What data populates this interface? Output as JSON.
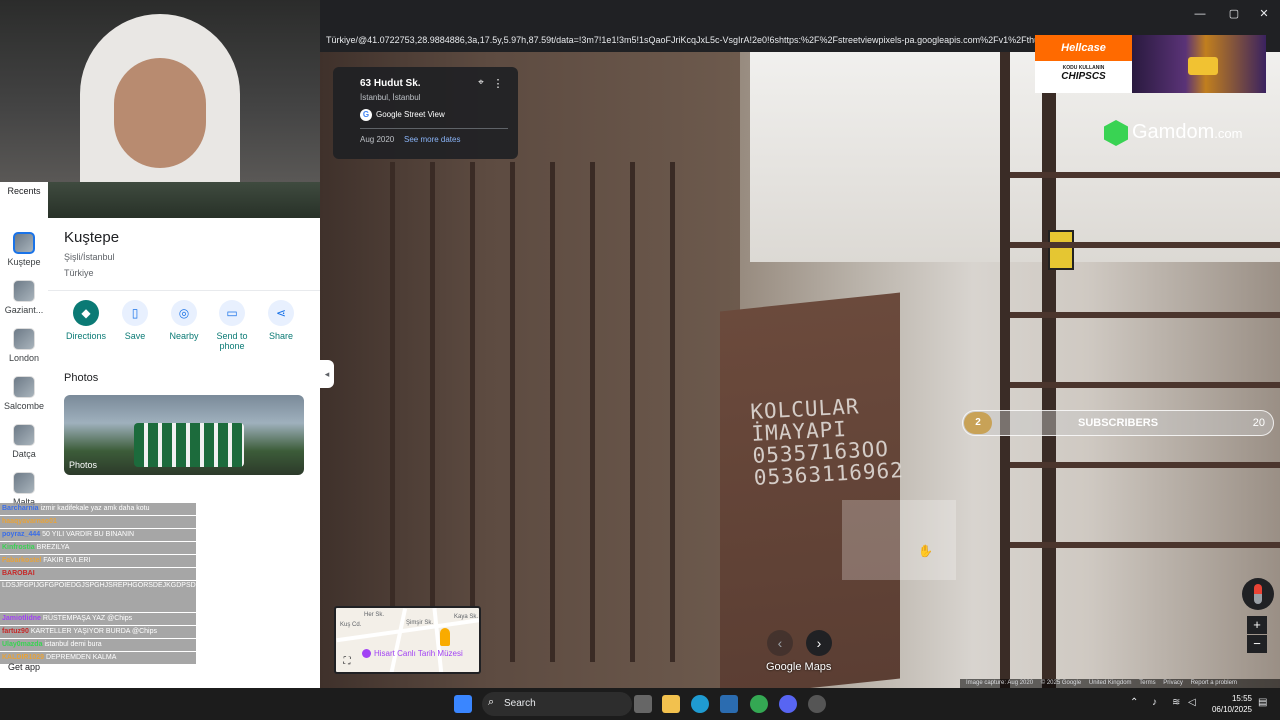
{
  "browser": {
    "url": "Türkiye/@41.0722753,28.9884886,3a,17.5y,5.97h,87.59t/data=!3m7!1e1!3m5!1sQaoFJriKcqJxL5c-VsgIrA!2e0!6shttps:%2F%2Fstreetviewpixels-pa.googleapis.com%2Fv1%2Fthu",
    "window_controls": {
      "minimize": "—",
      "maximize": "▢",
      "close": "✕"
    }
  },
  "rail": {
    "recents_label": "Recents",
    "items": [
      {
        "label": "Kuştepe",
        "active": true
      },
      {
        "label": "Gaziant...",
        "active": false
      },
      {
        "label": "London",
        "active": false
      },
      {
        "label": "Salcombe",
        "active": false
      },
      {
        "label": "Datça",
        "active": false
      },
      {
        "label": "Malta",
        "active": false
      }
    ],
    "get_app": "Get app"
  },
  "place": {
    "title": "Kuştepe",
    "district": "Şişli/İstanbul",
    "country": "Türkiye",
    "actions": [
      {
        "label": "Directions",
        "icon": "◆"
      },
      {
        "label": "Save",
        "icon": "▯"
      },
      {
        "label": "Nearby",
        "icon": "◎"
      },
      {
        "label": "Send to phone",
        "icon": "▭"
      },
      {
        "label": "Share",
        "icon": "⋖"
      }
    ],
    "photos_heading": "Photos",
    "photo_label": "Photos"
  },
  "streetview_card": {
    "address": "63 Hudut Sk.",
    "city": "İstanbul, İstanbul",
    "source": "Google Street View",
    "capture_date": "Aug 2020",
    "see_more": "See more dates"
  },
  "chat": [
    {
      "user": "Barcharnia",
      "text": "izmir kadifekale yaz amk daha kotu",
      "color": "#3a6ee8"
    },
    {
      "user": "haaqyavarnao01",
      "text": "",
      "color": "#e8a33a"
    },
    {
      "user": "poyraz_444",
      "text": "50 YILI VARDIR BU BINANIN",
      "color": "#3a6ee8"
    },
    {
      "user": "Kinfrostia",
      "text": "BREZILYA",
      "color": "#39d353"
    },
    {
      "user": "Fabarkostel",
      "text": "FAKIR EVLERI",
      "color": "#e8a33a"
    },
    {
      "user": "BAROBAI",
      "text": "",
      "color": "#c62828"
    },
    {
      "user": "",
      "text": "LDSJFGPIJGFGPOIEDGJSPGHJSREPHGORSDEJKGDPSDLGHKJSWOPHS/RHGPOIESWRJHREPIOHJWREPOJHRETHPORWHKJEPRTOHJETHOKE",
      "color": "#fff",
      "tall": true
    },
    {
      "user": "Jamiotlidne",
      "text": "RÜSTEMPAŞA YAZ @Chips",
      "color": "#a142f4"
    },
    {
      "user": "fartuz90",
      "text": "KARTELLER YAŞIYOR BURDA @Chips",
      "color": "#c62828"
    },
    {
      "user": "Ulay0mazda",
      "text": "istanbul demi bura",
      "color": "#39d353"
    },
    {
      "user": "KALDIR1029",
      "text": "DEPREMDEN KALMA",
      "color": "#e8a33a"
    }
  ],
  "ads": {
    "hellcase_brand": "Hellcase",
    "hellcase_code_label": "KODU KULLANIN",
    "hellcase_code": "CHIPSCS",
    "gamdom_brand": "Gamdom",
    "gamdom_tld": ".com"
  },
  "subscribers": {
    "badge": "2",
    "label": "SUBSCRIBERS",
    "value": "20"
  },
  "graffiti": [
    "KOLCULAR",
    "İMAYAPI",
    "05357163OO",
    "05363116962"
  ],
  "minimap": {
    "poi": "Hisart Canlı Tarih Müzesi",
    "streets": [
      "Şimşir Sk.",
      "Kaya Sk.",
      "Her Sk.",
      "Kuş Cd."
    ]
  },
  "nav": {
    "prev": "‹",
    "next": "›"
  },
  "watermark": "Google Maps",
  "footer": {
    "capture": "Image capture: Aug 2020",
    "copyright": "© 2025 Google",
    "region": "United Kingdom",
    "terms": "Terms",
    "privacy": "Privacy",
    "report": "Report a problem"
  },
  "zoom": {
    "in": "+",
    "out": "−"
  },
  "taskbar": {
    "search": "Search",
    "time": "15:55",
    "date": "06/10/2025"
  },
  "colors": {
    "accent_teal": "#0b7a75",
    "link_blue": "#8ab4f8",
    "hellcase_orange": "#ff6a00",
    "gamdom_green": "#39d353"
  }
}
